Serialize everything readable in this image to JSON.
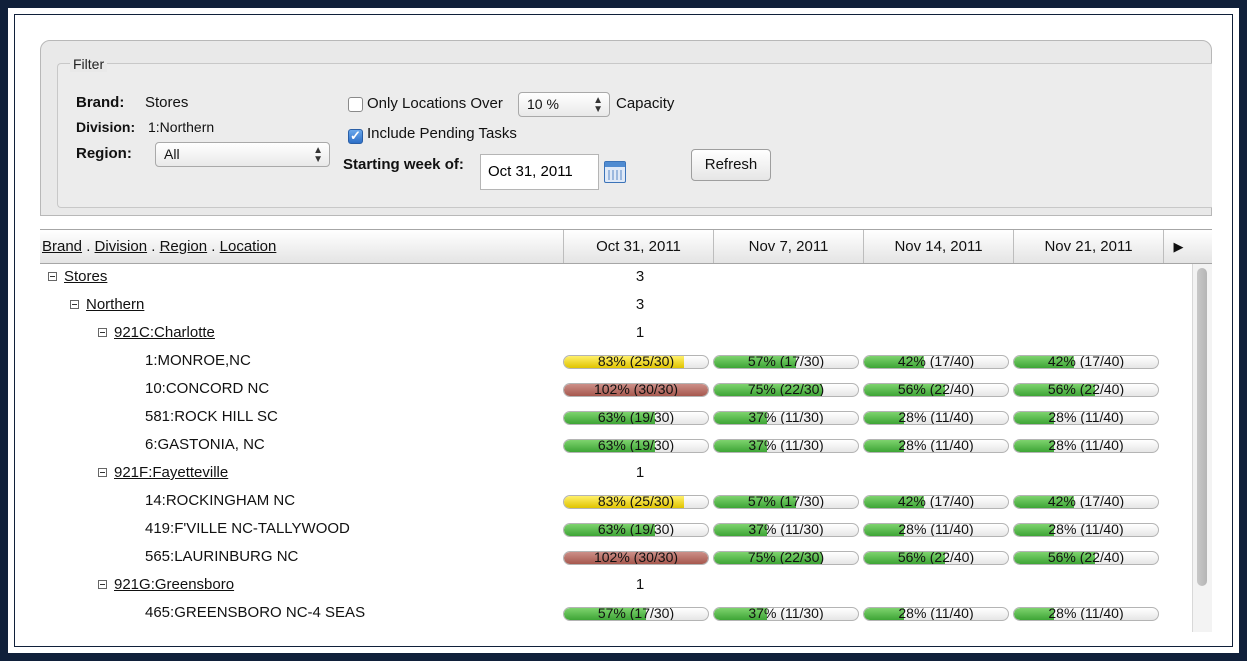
{
  "filter": {
    "legend": "Filter",
    "brand_label": "Brand:",
    "brand_value": "Stores",
    "division_label": "Division:",
    "division_value": "1:Northern",
    "region_label": "Region:",
    "region_value": "All",
    "only_locations_label": "Only Locations Over",
    "only_locations_checked": false,
    "capacity_value": "10 %",
    "capacity_label": "Capacity",
    "include_pending_label": "Include Pending Tasks",
    "include_pending_checked": true,
    "starting_week_label": "Starting week of:",
    "starting_week_value": "Oct 31, 2011",
    "refresh_label": "Refresh"
  },
  "grid": {
    "header_parts": [
      "Brand",
      "Division",
      "Region",
      "Location"
    ],
    "header_separator": " . ",
    "weeks": [
      "Oct 31, 2011",
      "Nov 7, 2011",
      "Nov 14, 2011",
      "Nov 21, 2011"
    ],
    "scroll_right_icon": "play-right-icon",
    "rows": [
      {
        "type": "node",
        "level": 0,
        "label": "Stores",
        "count": "3"
      },
      {
        "type": "node",
        "level": 1,
        "label": "Northern",
        "count": "3"
      },
      {
        "type": "node",
        "level": 2,
        "label": "921C:Charlotte",
        "count": "1"
      },
      {
        "type": "loc",
        "label": "1:MONROE,NC",
        "cells": [
          {
            "text": "83% (25/30)",
            "pct": 83,
            "color": "yellow"
          },
          {
            "text": "57% (17/30)",
            "pct": 57,
            "color": "green"
          },
          {
            "text": "42% (17/40)",
            "pct": 42,
            "color": "green"
          },
          {
            "text": "42% (17/40)",
            "pct": 42,
            "color": "green"
          }
        ]
      },
      {
        "type": "loc",
        "label": "10:CONCORD NC",
        "cells": [
          {
            "text": "102% (30/30)",
            "pct": 102,
            "color": "red"
          },
          {
            "text": "75% (22/30)",
            "pct": 75,
            "color": "green"
          },
          {
            "text": "56% (22/40)",
            "pct": 56,
            "color": "green"
          },
          {
            "text": "56% (22/40)",
            "pct": 56,
            "color": "green"
          }
        ]
      },
      {
        "type": "loc",
        "label": "581:ROCK HILL SC",
        "cells": [
          {
            "text": "63% (19/30)",
            "pct": 63,
            "color": "green"
          },
          {
            "text": "37% (11/30)",
            "pct": 37,
            "color": "green"
          },
          {
            "text": "28% (11/40)",
            "pct": 28,
            "color": "green"
          },
          {
            "text": "28% (11/40)",
            "pct": 28,
            "color": "green"
          }
        ]
      },
      {
        "type": "loc",
        "label": "6:GASTONIA, NC",
        "cells": [
          {
            "text": "63% (19/30)",
            "pct": 63,
            "color": "green"
          },
          {
            "text": "37% (11/30)",
            "pct": 37,
            "color": "green"
          },
          {
            "text": "28% (11/40)",
            "pct": 28,
            "color": "green"
          },
          {
            "text": "28% (11/40)",
            "pct": 28,
            "color": "green"
          }
        ]
      },
      {
        "type": "node",
        "level": 2,
        "label": "921F:Fayetteville",
        "count": "1"
      },
      {
        "type": "loc",
        "label": "14:ROCKINGHAM NC",
        "cells": [
          {
            "text": "83% (25/30)",
            "pct": 83,
            "color": "yellow"
          },
          {
            "text": "57% (17/30)",
            "pct": 57,
            "color": "green"
          },
          {
            "text": "42% (17/40)",
            "pct": 42,
            "color": "green"
          },
          {
            "text": "42% (17/40)",
            "pct": 42,
            "color": "green"
          }
        ]
      },
      {
        "type": "loc",
        "label": "419:F'VILLE NC-TALLYWOOD",
        "cells": [
          {
            "text": "63% (19/30)",
            "pct": 63,
            "color": "green"
          },
          {
            "text": "37% (11/30)",
            "pct": 37,
            "color": "green"
          },
          {
            "text": "28% (11/40)",
            "pct": 28,
            "color": "green"
          },
          {
            "text": "28% (11/40)",
            "pct": 28,
            "color": "green"
          }
        ]
      },
      {
        "type": "loc",
        "label": "565:LAURINBURG NC",
        "cells": [
          {
            "text": "102% (30/30)",
            "pct": 102,
            "color": "red"
          },
          {
            "text": "75% (22/30)",
            "pct": 75,
            "color": "green"
          },
          {
            "text": "56% (22/40)",
            "pct": 56,
            "color": "green"
          },
          {
            "text": "56% (22/40)",
            "pct": 56,
            "color": "green"
          }
        ]
      },
      {
        "type": "node",
        "level": 2,
        "label": "921G:Greensboro",
        "count": "1"
      },
      {
        "type": "loc",
        "label": "465:GREENSBORO NC-4 SEAS",
        "cells": [
          {
            "text": "57% (17/30)",
            "pct": 57,
            "color": "green"
          },
          {
            "text": "37% (11/30)",
            "pct": 37,
            "color": "green"
          },
          {
            "text": "28% (11/40)",
            "pct": 28,
            "color": "green"
          },
          {
            "text": "28% (11/40)",
            "pct": 28,
            "color": "green"
          }
        ]
      }
    ]
  }
}
